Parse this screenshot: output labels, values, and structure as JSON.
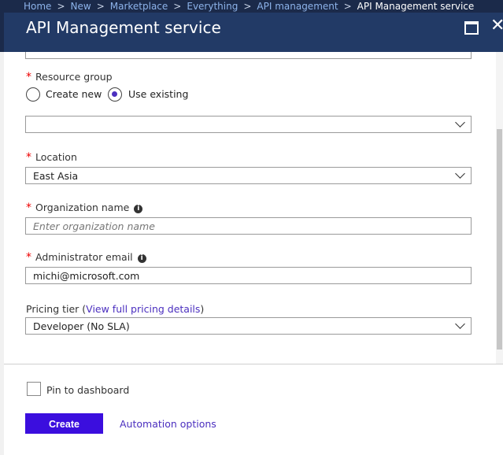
{
  "breadcrumb": {
    "items": [
      "Home",
      "New",
      "Marketplace",
      "Everything",
      "API management",
      "API Management service"
    ],
    "separator": ">"
  },
  "blade": {
    "title": "API Management service",
    "maximize_icon": "maximize-icon",
    "close_glyph": "✕"
  },
  "form": {
    "resource_group": {
      "label": "Resource group",
      "required_mark": "*",
      "options": [
        "Create new",
        "Use existing"
      ],
      "selected": "Use existing",
      "value": ""
    },
    "location": {
      "label": "Location",
      "required_mark": "*",
      "value": "East Asia"
    },
    "organization_name": {
      "label": "Organization name",
      "required_mark": "*",
      "placeholder": "Enter organization name",
      "info_glyph": "i"
    },
    "admin_email": {
      "label": "Administrator email",
      "required_mark": "*",
      "value": "michi@microsoft.com",
      "info_glyph": "i"
    },
    "pricing_tier": {
      "label_prefix": "Pricing tier (",
      "link_text": "View full pricing details",
      "label_suffix": ")",
      "value": "Developer (No SLA)"
    }
  },
  "footer": {
    "pin_label": "Pin to dashboard",
    "pin_checked": false,
    "create_label": "Create",
    "automation_label": "Automation options"
  },
  "colors": {
    "header_bg": "#223a66",
    "accent": "#3b0ede",
    "link": "#4b2fbf",
    "required": "#e00000"
  }
}
